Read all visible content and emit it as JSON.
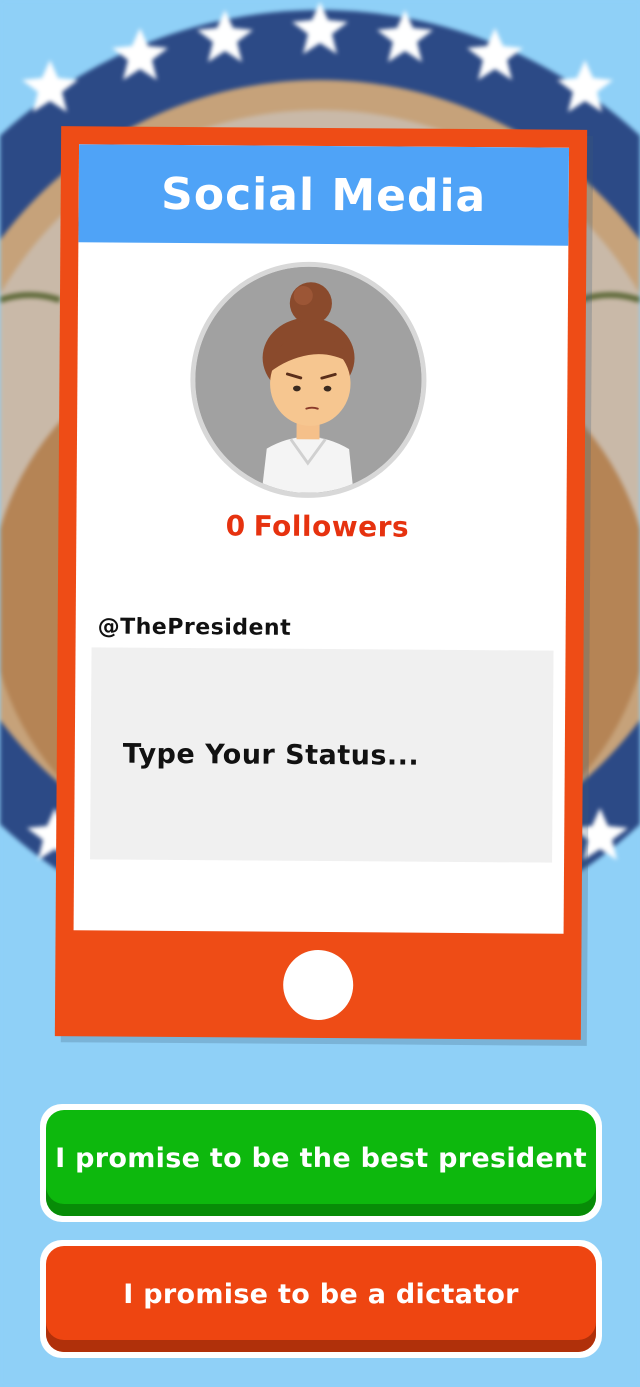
{
  "header": {
    "title": "Social Media"
  },
  "profile": {
    "followers_count": "0",
    "followers_label": "Followers",
    "handle": "@ThePresident"
  },
  "status": {
    "placeholder": "Type Your Status..."
  },
  "choices": [
    {
      "label": "I promise to be the best president",
      "color": "#0db80d"
    },
    {
      "label": "I promise to be a dictator",
      "color": "#ee4511"
    }
  ],
  "colors": {
    "phone_frame": "#ee4c16",
    "header": "#4fa3f7",
    "followers_text": "#e6320f",
    "background_sky": "#8fd0f7"
  }
}
